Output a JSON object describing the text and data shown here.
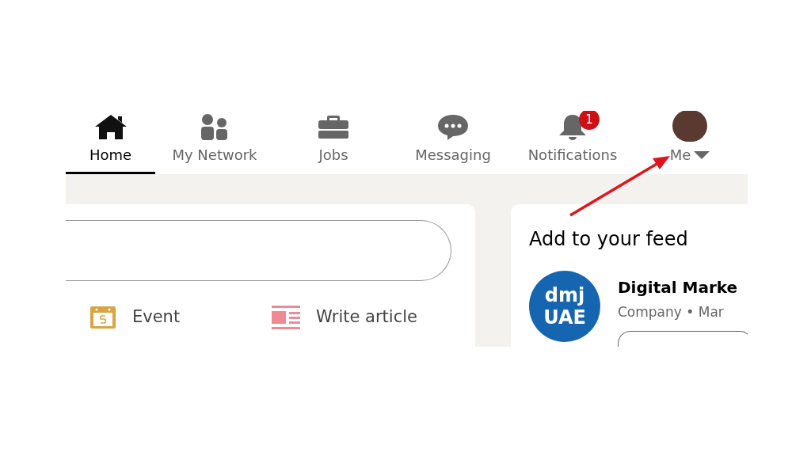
{
  "nav": {
    "items": [
      {
        "kind": "home",
        "label": "Home",
        "selected": true
      },
      {
        "kind": "network",
        "label": "My Network",
        "selected": false
      },
      {
        "kind": "jobs",
        "label": "Jobs",
        "selected": false
      },
      {
        "kind": "messaging",
        "label": "Messaging",
        "selected": false
      },
      {
        "kind": "notifications",
        "label": "Notifications",
        "selected": false,
        "badge": "1"
      },
      {
        "kind": "me",
        "label": "Me",
        "selected": false
      }
    ]
  },
  "share_box": {
    "actions": [
      {
        "kind": "event",
        "label": "Event"
      },
      {
        "kind": "article",
        "label": "Write article"
      }
    ]
  },
  "feed_suggestions": {
    "title": "Add to your feed",
    "items": [
      {
        "logo": [
          "dmj",
          "UAE"
        ],
        "name": "Digital Marke",
        "subtitle": "Company • Mar"
      }
    ]
  }
}
